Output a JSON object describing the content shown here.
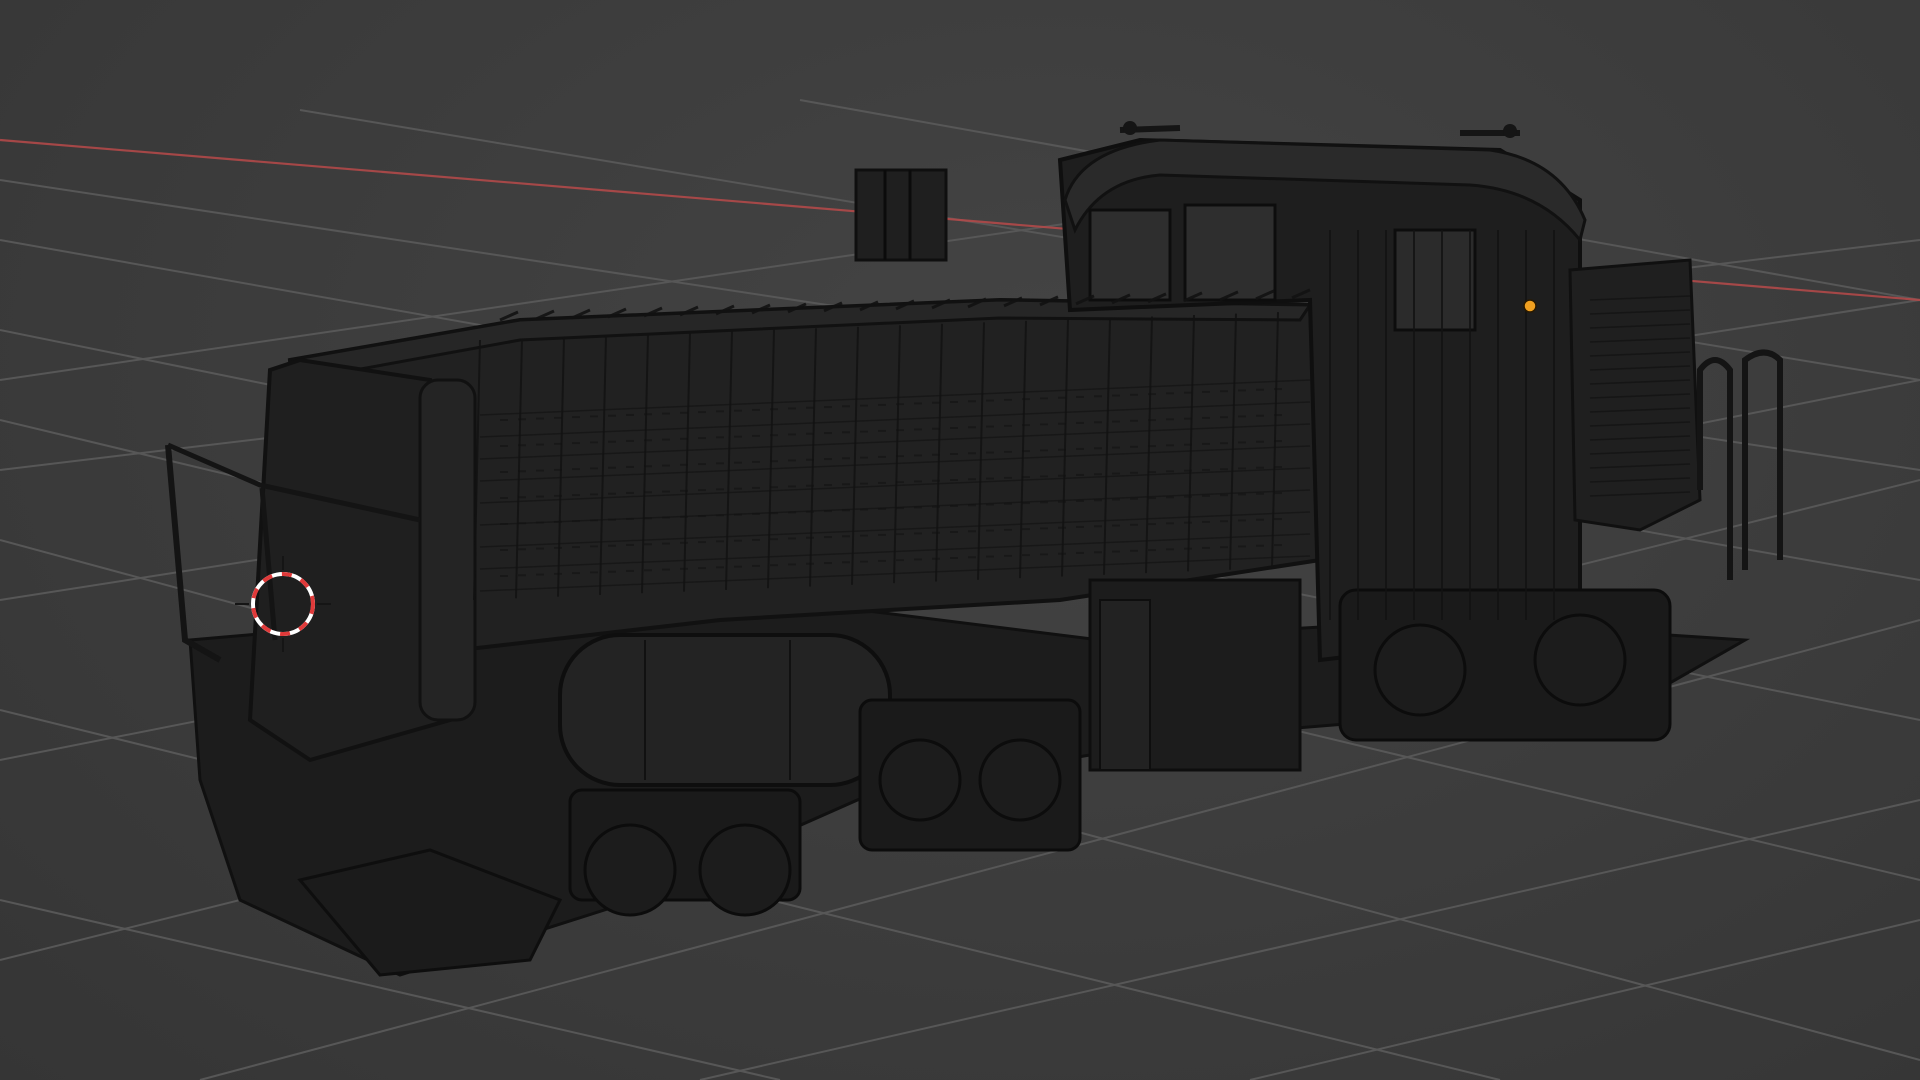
{
  "viewport": {
    "mode": "3d-viewport",
    "shading": "wireframe",
    "background_color": "#3d3d3d",
    "grid_color": "#575757",
    "x_axis_color": "#b84a4a",
    "mesh_color": "#1d1d1d",
    "wire_color": "#121212",
    "origin_color": "#f0a020",
    "cursor_color_a": "#e03a3a",
    "cursor_color_b": "#ffffff"
  },
  "scene": {
    "object": "diesel-locomotive",
    "selected_origin_visible": true,
    "cursor_3d_visible": true
  }
}
